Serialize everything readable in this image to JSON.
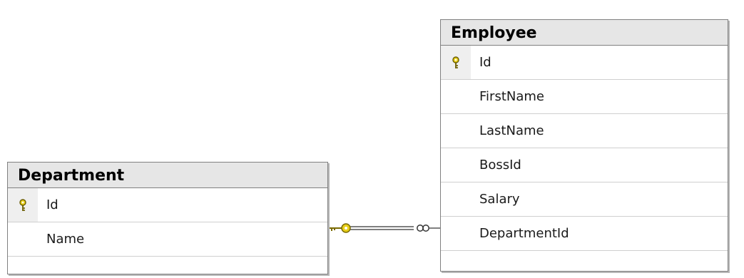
{
  "tables": {
    "employee": {
      "title": "Employee",
      "columns": [
        {
          "name": "Id",
          "primary_key": true
        },
        {
          "name": "FirstName",
          "primary_key": false
        },
        {
          "name": "LastName",
          "primary_key": false
        },
        {
          "name": "BossId",
          "primary_key": false
        },
        {
          "name": "Salary",
          "primary_key": false
        },
        {
          "name": "DepartmentId",
          "primary_key": false
        }
      ]
    },
    "department": {
      "title": "Department",
      "columns": [
        {
          "name": "Id",
          "primary_key": true
        },
        {
          "name": "Name",
          "primary_key": false
        }
      ]
    }
  },
  "relationship": {
    "from": "Department",
    "to": "Employee",
    "one_end_icon": "key-icon",
    "many_end_icon": "infinity-icon"
  },
  "colors": {
    "key": "#d4b800",
    "header_bg": "#e6e6e6",
    "border": "#808080"
  }
}
